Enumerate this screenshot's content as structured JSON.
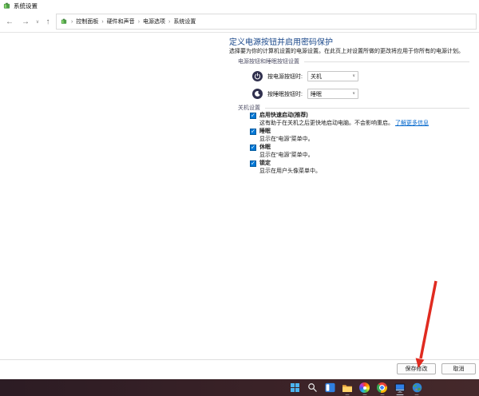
{
  "window": {
    "title": "系统设置",
    "app_icon": "power-options-icon"
  },
  "glyphs": {
    "back": "←",
    "forward": "→",
    "up": "↑",
    "chevron_down": "∨",
    "recent_pages_chevron": "∨",
    "check": "✓",
    "crumb_sep": "›"
  },
  "address_bar": {
    "crumbs": [
      "控制面板",
      "硬件和声音",
      "电源选项",
      "系统设置"
    ]
  },
  "page": {
    "title": "定义电源按钮并启用密码保护",
    "subtitle": "选择要为你的计算机设置的电源设置。在此页上对设置所做的更改将应用于你所有的电源计划。",
    "power_section": {
      "header": "电源按钮和睡眠按钮设置",
      "rows": [
        {
          "icon": "power-icon",
          "label": "按电源按钮时:",
          "value": "关机"
        },
        {
          "icon": "sleep-icon",
          "label": "按睡眠按钮时:",
          "value": "睡眠"
        }
      ]
    },
    "shutdown_section": {
      "header": "关机设置",
      "options": [
        {
          "checked": true,
          "label": "启用快速启动(推荐)",
          "description": "这有助于在关机之后更快地启动电脑。不会影响重启。",
          "link": "了解更多信息"
        },
        {
          "checked": true,
          "label": "睡眠",
          "description": "显示在“电源”菜单中。"
        },
        {
          "checked": true,
          "label": "休眠",
          "description": "显示在“电源”菜单中。"
        },
        {
          "checked": true,
          "label": "锁定",
          "description": "显示在用户头像菜单中。"
        }
      ]
    }
  },
  "footer": {
    "save": "保存修改",
    "cancel": "取消"
  },
  "annotation": {
    "type": "red-arrow",
    "points_to": "save-button",
    "color": "#e02b20"
  },
  "taskbar": {
    "icons": [
      "start",
      "search",
      "task-view",
      "file-explorer",
      "photos",
      "chrome",
      "system-settings-window",
      "internet-globe"
    ],
    "active_icon": "system-settings-window"
  },
  "colors": {
    "heading_blue": "#19478a",
    "link_blue": "#0066cc",
    "checkbox_blue": "#0078d7",
    "taskbar_bg": "#3a2227",
    "arrow_red": "#e02b20"
  }
}
